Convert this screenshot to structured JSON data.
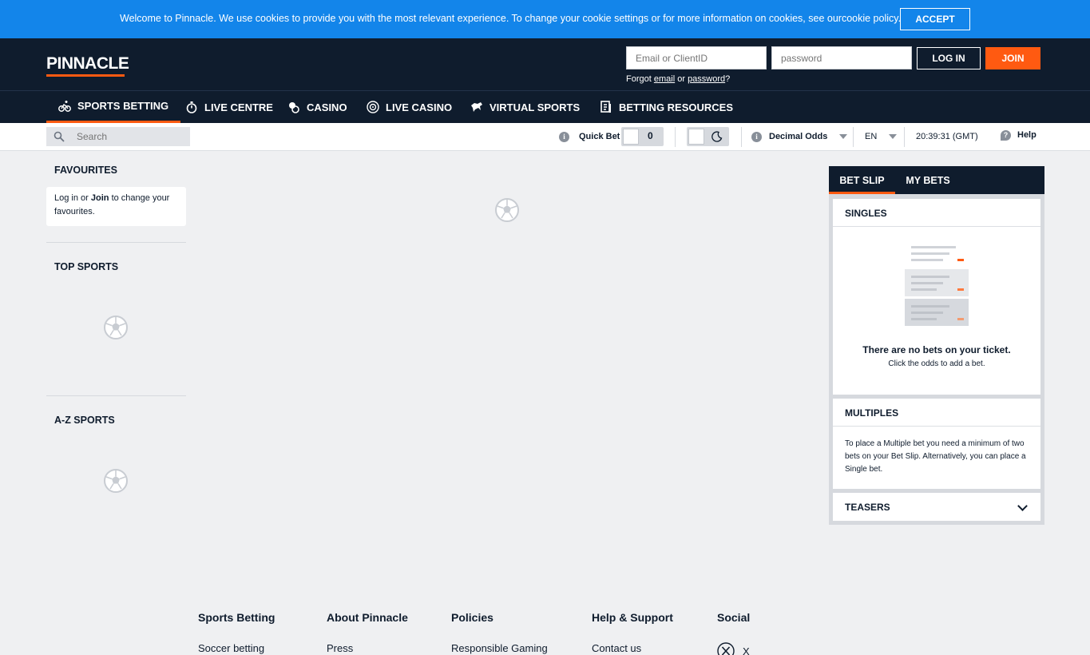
{
  "cookie": {
    "text": "Welcome to Pinnacle. We use cookies to provide you with the most relevant experience. To change your cookie settings or for more information on cookies, see ourcookie policy.",
    "accept_label": "ACCEPT"
  },
  "header": {
    "logo_text": "PINNACLE",
    "email_placeholder": "Email or ClientID",
    "password_placeholder": "password",
    "login_label": "LOG IN",
    "join_label": "JOIN",
    "forgot_prefix": "Forgot",
    "forgot_email": "email",
    "forgot_or": "or",
    "forgot_password": "password",
    "forgot_suffix": "?"
  },
  "nav": {
    "items": [
      {
        "label": "SPORTS BETTING",
        "icon": "cyclist-icon",
        "active": true
      },
      {
        "label": "LIVE CENTRE",
        "icon": "stopwatch-icon"
      },
      {
        "label": "CASINO",
        "icon": "casino-chips-icon"
      },
      {
        "label": "LIVE CASINO",
        "icon": "roulette-icon"
      },
      {
        "label": "VIRTUAL SPORTS",
        "icon": "virtual-horse-icon"
      },
      {
        "label": "BETTING RESOURCES",
        "icon": "document-icon"
      }
    ]
  },
  "toolbar": {
    "search_placeholder": "Search",
    "quick_bet_label": "Quick Bet",
    "quick_bet_value": "0",
    "odds_format": "Decimal Odds",
    "language": "EN",
    "clock": "20:39:31 (GMT)",
    "help_label": "Help"
  },
  "sidebar": {
    "favourites_title": "FAVOURITES",
    "fav_login": "Log in",
    "fav_or": " or ",
    "fav_join": "Join",
    "fav_rest": " to change your favourites.",
    "top_sports_title": "TOP SPORTS",
    "az_sports_title": "A-Z SPORTS"
  },
  "betslip": {
    "tab_betslip": "BET SLIP",
    "tab_mybets": "MY BETS",
    "singles_title": "SINGLES",
    "empty_title": "There are no bets on your ticket.",
    "empty_sub": "Click the odds to add a bet.",
    "multiples_title": "MULTIPLES",
    "multiples_text": "To place a Multiple bet you need a minimum of two bets on your Bet Slip. Alternatively, you can place a Single bet.",
    "teasers_title": "TEASERS"
  },
  "footer": {
    "columns": [
      {
        "title": "Sports Betting",
        "link": "Soccer betting"
      },
      {
        "title": "About Pinnacle",
        "link": "Press"
      },
      {
        "title": "Policies",
        "link": "Responsible Gaming"
      },
      {
        "title": "Help & Support",
        "link": "Contact us"
      },
      {
        "title": "Social",
        "link": "X"
      }
    ]
  },
  "colors": {
    "cookie_bg": "#1385ea",
    "header_bg": "#0f1c2d",
    "accent": "#ff5a11",
    "page_bg": "#eff0f2"
  }
}
